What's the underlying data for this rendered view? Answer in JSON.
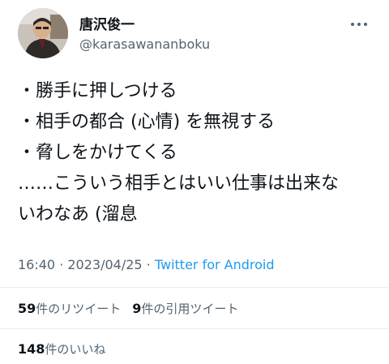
{
  "author": {
    "display_name": "唐沢俊一",
    "handle": "@karasawananboku"
  },
  "menu": {
    "more_icon": "more-horizontal-icon"
  },
  "tweet": {
    "lines": [
      "・勝手に押しつける",
      "・相手の都合 (心情) を無視する",
      "・脅しをかけてくる",
      "……こういう相手とはいい仕事は出来な",
      "いわなあ (溜息"
    ]
  },
  "meta": {
    "time": "16:40",
    "separator1": " · ",
    "date": "2023/04/25",
    "separator2": " · ",
    "source": "Twitter for Android"
  },
  "stats": {
    "retweets_count": "59",
    "retweets_label": "件のリツイート",
    "quotes_count": "9",
    "quotes_label": "件の引用ツイート",
    "likes_count": "148",
    "likes_label": "件のいいね"
  },
  "colors": {
    "text": "#0f1419",
    "secondary": "#536471",
    "link": "#1d9bf0",
    "divider": "#e6ecf0"
  }
}
